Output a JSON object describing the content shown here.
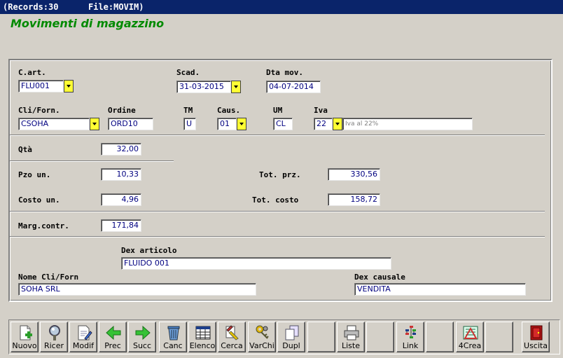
{
  "titlebar": {
    "records": "(Records:30",
    "file": "File:MOVIM)"
  },
  "form_title": "Movimenti di magazzino",
  "fields": {
    "cart": {
      "label": "C.art.",
      "value": "FLU001"
    },
    "scad": {
      "label": "Scad.",
      "value": "31-03-2015"
    },
    "dta_mov": {
      "label": "Dta mov.",
      "value": "04-07-2014"
    },
    "cliforn": {
      "label": "Cli/Forn.",
      "value": "CSOHA"
    },
    "ordine": {
      "label": "Ordine",
      "value": "ORD10"
    },
    "tm": {
      "label": "TM",
      "value": "U"
    },
    "caus": {
      "label": "Caus.",
      "value": "01"
    },
    "um": {
      "label": "UM",
      "value": "CL"
    },
    "iva": {
      "label": "Iva",
      "value": "22",
      "desc": "Iva al 22%"
    },
    "qta": {
      "label": "Qtà",
      "value": "32,00"
    },
    "pzo_un": {
      "label": "Pzo un.",
      "value": "10,33"
    },
    "tot_prz": {
      "label": "Tot. prz.",
      "value": "330,56"
    },
    "costo_un": {
      "label": "Costo un.",
      "value": "4,96"
    },
    "tot_costo": {
      "label": "Tot. costo",
      "value": "158,72"
    },
    "marg": {
      "label": "Marg.contr.",
      "value": "171,84"
    },
    "dex_art": {
      "label": "Dex articolo",
      "value": "FLUIDO 001"
    },
    "nome_cli": {
      "label": "Nome Cli/Forn",
      "value": "SOHA SRL"
    },
    "dex_caus": {
      "label": "Dex causale",
      "value": "VENDITA"
    }
  },
  "toolbar": {
    "nuovo": "Nuovo",
    "ricer": "Ricer",
    "modif": "Modif",
    "prec": "Prec",
    "succ": "Succ",
    "canc": "Canc",
    "elenco": "Elenco",
    "cerca": "Cerca",
    "varchi": "VarChi",
    "dupl": "Dupl",
    "liste": "Liste",
    "link": "Link",
    "crea": "4Crea",
    "uscita": "Uscita"
  },
  "icons": {
    "nuovo": "new-document-icon",
    "ricer": "magnifier-icon",
    "modif": "edit-document-icon",
    "prec": "arrow-left-icon",
    "succ": "arrow-right-icon",
    "canc": "trash-icon",
    "elenco": "table-icon",
    "cerca": "search-highlight-icon",
    "varchi": "keys-icon",
    "dupl": "duplicate-icon",
    "liste": "printer-icon",
    "link": "link-tree-icon",
    "crea": "create-icon",
    "uscita": "exit-door-icon"
  },
  "colors": {
    "titlebar": "#0a246a",
    "form_title": "#008a00",
    "field_text": "#000080",
    "dropdown": "#ffff33",
    "background": "#d4d0c8"
  }
}
